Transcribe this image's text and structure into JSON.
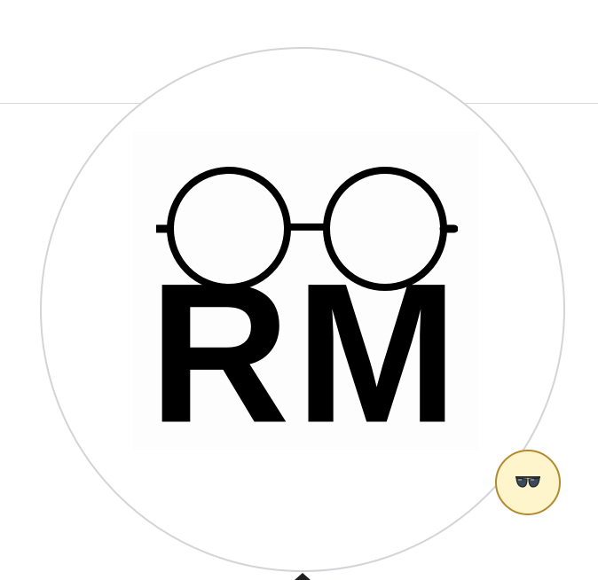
{
  "profile": {
    "avatar_label": "RM",
    "avatar_letters": "RM",
    "badge_icon": "sunglasses-icon"
  },
  "colors": {
    "divider": "#d9d9d9",
    "avatar_border": "#d4d4d8",
    "badge_background": "#fff5cc",
    "badge_border": "#b38a2d"
  }
}
